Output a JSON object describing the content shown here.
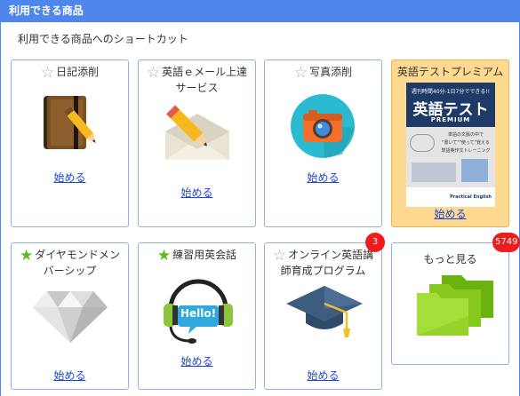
{
  "header": {
    "title": "利用できる商品"
  },
  "subtitle": "利用できる商品へのショートカット",
  "cards": [
    {
      "title": "日記添削",
      "star": "star-outline-icon",
      "link": "始める"
    },
    {
      "title": "英語ｅメール上達サービス",
      "star": "star-outline-icon",
      "link": "始める"
    },
    {
      "title": "写真添削",
      "star": "star-outline-icon",
      "link": "始める"
    },
    {
      "title": "英語テストプレミアム",
      "link": "始める",
      "book": {
        "top": "週刊時間40分-1日7分でできる!!",
        "title": "英語テスト",
        "sub": "PREMIUM",
        "line1": "単語の文脈の中で",
        "line2": "\"書いて\"\"使って\"覚える",
        "line3": "単語英作文トレーニング",
        "brand": "Practical English"
      }
    },
    {
      "title": "ダイヤモンドメンバーシップ",
      "star": "star-filled-icon",
      "link": "始める"
    },
    {
      "title": "練習用英会話",
      "star": "star-filled-icon",
      "link": "始める",
      "bubble": "Hello!"
    },
    {
      "title": "オンライン英語講師育成プログラム",
      "star": "star-outline-icon",
      "link": "始める",
      "badge": "3"
    },
    {
      "title": "もっと見る",
      "badge": "5749"
    }
  ],
  "colors": {
    "header": "#4f86ec",
    "card_border": "#8fb0ea",
    "premium_bg": "#ffd98f",
    "link": "#1a44d6",
    "badge": "#f01b1b",
    "star_on": "#5dbb1e",
    "star_off": "#aaaaaa"
  }
}
